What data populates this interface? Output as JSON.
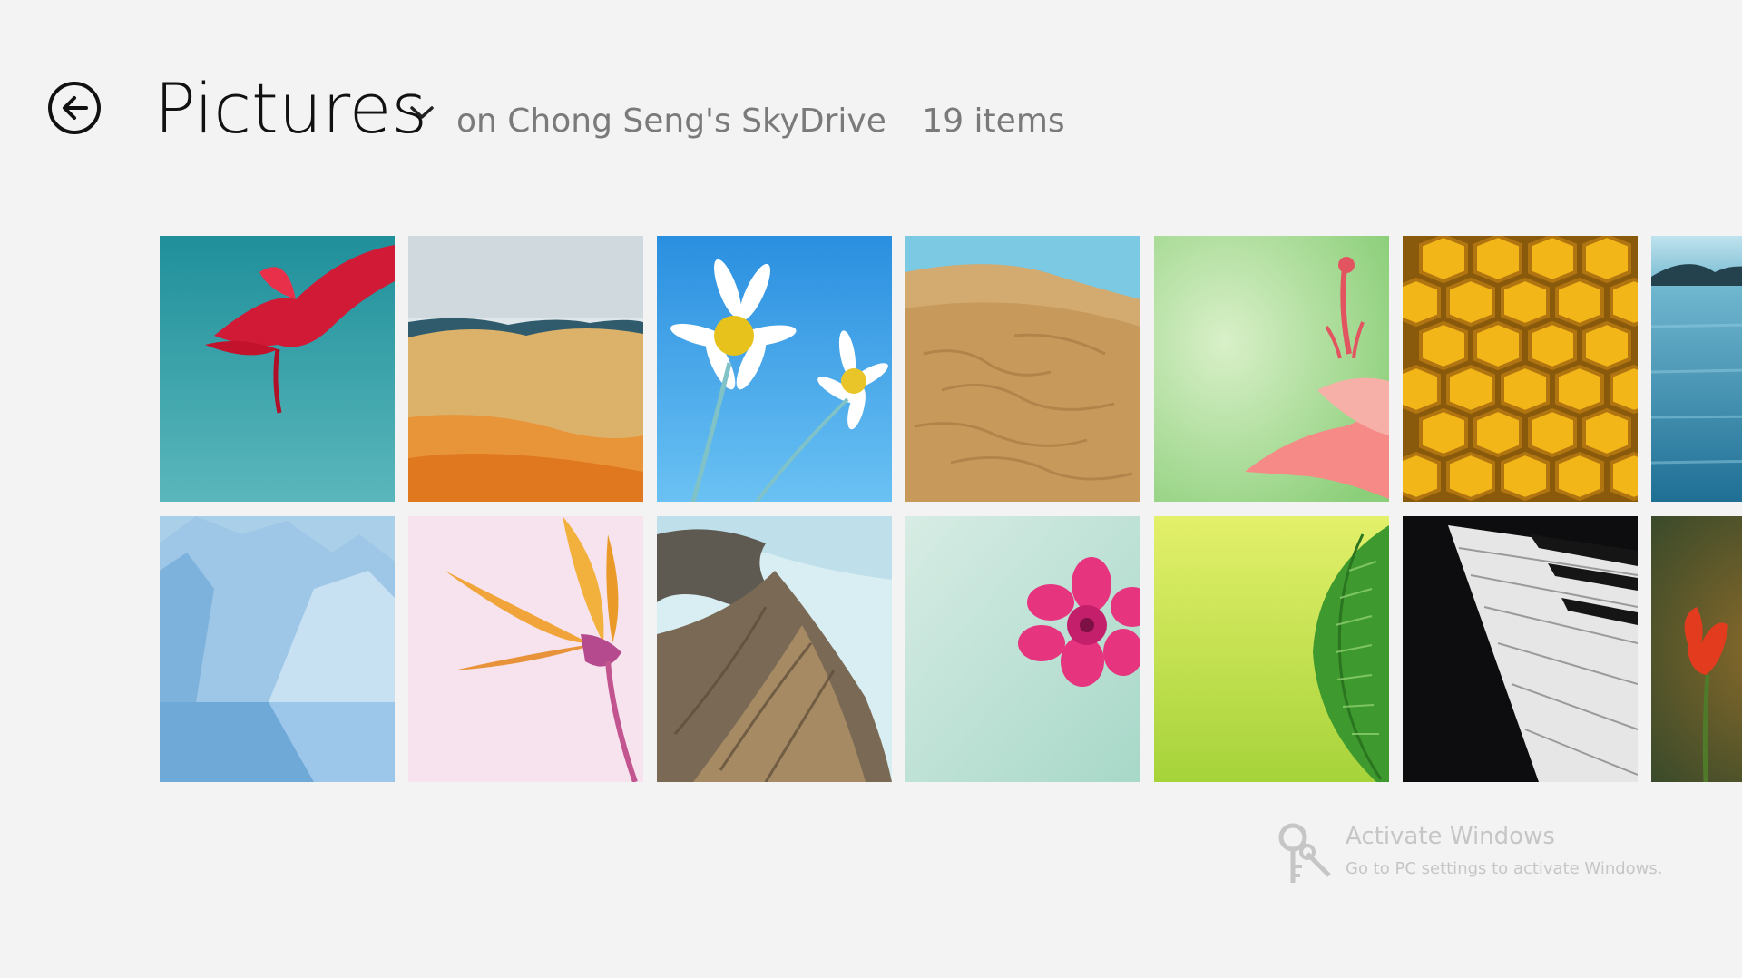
{
  "header": {
    "title": "Pictures",
    "location": "on Chong Seng's SkyDrive",
    "item_count": "19 items",
    "back_icon": "back-arrow-icon",
    "dropdown_icon": "chevron-down-icon"
  },
  "gallery": {
    "rows": [
      [
        "red-flower-on-teal",
        "desert-hills-landscape",
        "daisies-on-blue-sky",
        "sand-dunes",
        "pink-lily-on-green",
        "honeycomb",
        "blue-lake"
      ],
      [
        "blue-iceberg",
        "yellow-bird-of-paradise-flower",
        "rocky-coastline",
        "pink-flower-on-mint",
        "green-fern-leaf",
        "piano-keys",
        "red-tulip"
      ]
    ]
  },
  "watermark": {
    "title": "Activate Windows",
    "subtitle": "Go to PC settings to activate Windows.",
    "icon": "key-icon"
  },
  "colors": {
    "background": "#f3f3f3",
    "title": "#111111",
    "subtitle": "#7a7a7a",
    "watermark": "#c6c6c6"
  }
}
